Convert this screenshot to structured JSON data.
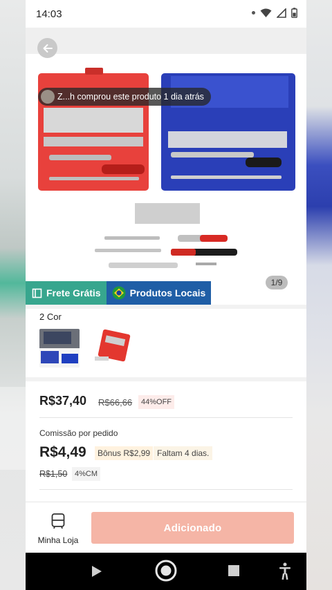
{
  "status_bar": {
    "time": "14:03"
  },
  "product": {
    "buyer_toast": "Z...h comprou este produto 1 dia atrás",
    "image_counter": "1/9"
  },
  "badges": {
    "free_shipping": "Frete Grátis",
    "local_products": "Produtos Locais"
  },
  "variants": {
    "label": "2 Cor"
  },
  "pricing": {
    "current_price": "R$37,40",
    "original_price": "R$66,66",
    "discount": "44%OFF"
  },
  "commission": {
    "label": "Comissão por pedido",
    "value": "R$4,49",
    "bonus": "Bônus R$2,99",
    "days_left": "Faltam 4 dias.",
    "old_value": "R$1,50",
    "percent": "4%CM"
  },
  "bottom_bar": {
    "store_label": "Minha Loja",
    "added_label": "Adicionado"
  },
  "colors": {
    "free_shipping_bg": "#37a68e",
    "local_products_bg": "#1f5ea6",
    "added_button_bg": "#f5b5a6",
    "red_case": "#e8413c",
    "blue_case": "#2a3fb8"
  }
}
